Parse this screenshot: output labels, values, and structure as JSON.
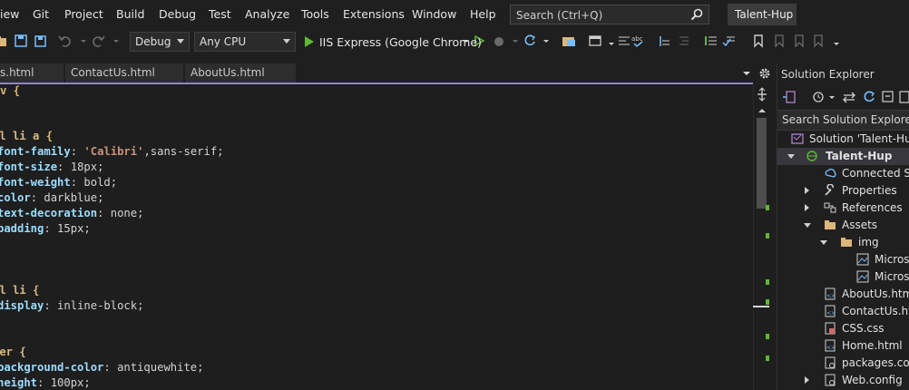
{
  "menu": {
    "items": [
      "iew",
      "Git",
      "Project",
      "Build",
      "Debug",
      "Test",
      "Analyze",
      "Tools",
      "Extensions",
      "Window",
      "Help"
    ],
    "search_placeholder": "Search (Ctrl+Q)",
    "project_name": "Talent-Hup"
  },
  "toolbar": {
    "config": "Debug",
    "platform": "Any CPU",
    "run_target": "IIS Express (Google Chrome)"
  },
  "tabs": [
    {
      "label": "s.html"
    },
    {
      "label": "ContactUs.html"
    },
    {
      "label": "AboutUs.html"
    }
  ],
  "editor": {
    "lines": [
      {
        "sel": "v {"
      },
      {
        "sel": "ul li a {"
      },
      {
        "prop": "font-family",
        "str": "'Calibri'",
        "val": ",sans-serif;"
      },
      {
        "prop": "font-size",
        "val": " 18px;"
      },
      {
        "prop": "font-weight",
        "val": " bold;"
      },
      {
        "prop": "color",
        "val": " darkblue;"
      },
      {
        "prop": "text-decoration",
        "val": " none;"
      },
      {
        "prop": "padding",
        "val": " 15px;"
      },
      {
        "sel": "ul li {"
      },
      {
        "prop": "display",
        "val": " inline-block;"
      },
      {
        "sel": "der {"
      },
      {
        "prop": "background-color",
        "val": " antiquewhite;"
      },
      {
        "prop": "height",
        "val": " 100px;"
      }
    ]
  },
  "solution_explorer": {
    "title": "Solution Explorer",
    "search_placeholder": "Search Solution Explorer (C",
    "items": [
      {
        "label": "Solution 'Talent-Hup",
        "icon": "solution-icon"
      },
      {
        "label": "Talent-Hup",
        "icon": "web-project-icon"
      },
      {
        "label": "Connected Se",
        "icon": "connected-services-icon"
      },
      {
        "label": "Properties",
        "icon": "wrench-icon"
      },
      {
        "label": "References",
        "icon": "references-icon"
      },
      {
        "label": "Assets",
        "icon": "folder-icon"
      },
      {
        "label": "img",
        "icon": "folder-icon"
      },
      {
        "label": "Microso",
        "icon": "image-file-icon"
      },
      {
        "label": "Microso",
        "icon": "image-file-icon"
      },
      {
        "label": "AboutUs.html",
        "icon": "html-file-icon"
      },
      {
        "label": "ContactUs.htm",
        "icon": "html-file-icon"
      },
      {
        "label": "CSS.css",
        "icon": "css-file-icon"
      },
      {
        "label": "Home.html",
        "icon": "html-file-icon"
      },
      {
        "label": "packages.conf",
        "icon": "config-file-icon"
      },
      {
        "label": "Web.config",
        "icon": "config-file-icon"
      }
    ]
  },
  "colors": {
    "accent": "#9184c8",
    "selector": "#d7ba7d",
    "property": "#9cdcfe",
    "string": "#ce9178"
  }
}
